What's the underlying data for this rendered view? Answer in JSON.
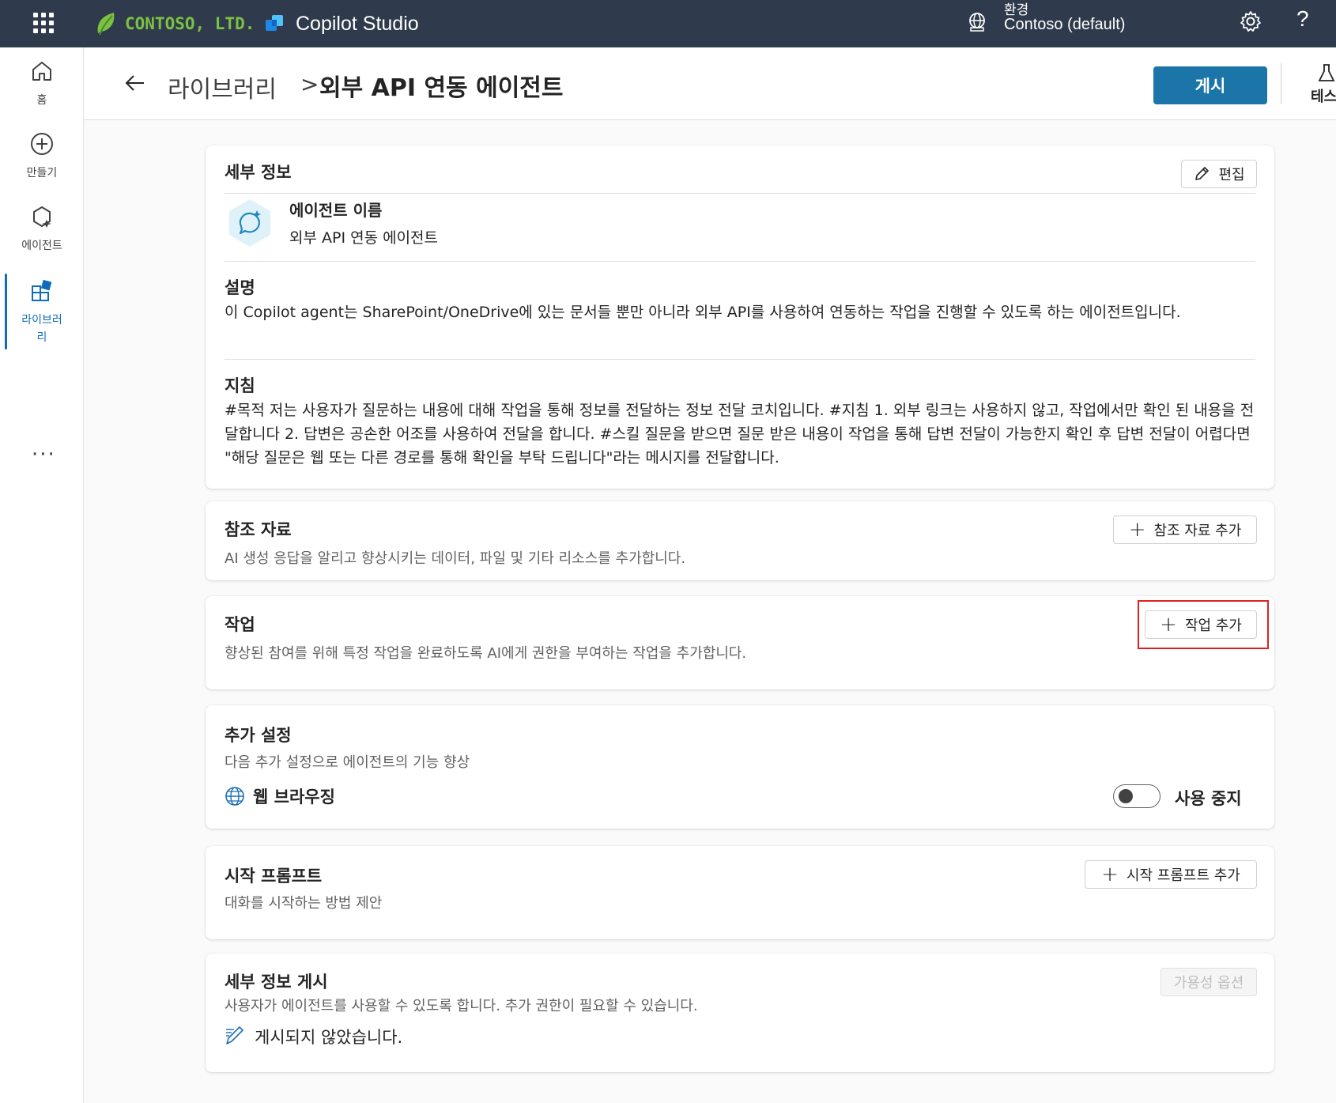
{
  "topbar": {
    "company": "CONTOSO, LTD.",
    "product": "Copilot Studio",
    "env_label": "환경",
    "env_name": "Contoso (default)",
    "help": "?"
  },
  "nav": {
    "items": [
      {
        "label": "홈"
      },
      {
        "label": "만들기"
      },
      {
        "label": "에이전트"
      },
      {
        "label": "라이브러리"
      }
    ],
    "more": "···"
  },
  "header": {
    "crumb_parent": "라이브러리",
    "crumb_sep": ">",
    "crumb_current": "외부 API 연동 에이전트",
    "publish_label": "게시",
    "test_label": "테스"
  },
  "details": {
    "title": "세부 정보",
    "edit_label": "편집",
    "agent_name_label": "에이전트 이름",
    "agent_name": "외부 API 연동 에이전트",
    "description_title": "설명",
    "description": "이 Copilot agent는 SharePoint/OneDrive에 있는 문서들 뿐만 아니라 외부 API를 사용하여 연동하는 작업을 진행할 수 있도록 하는 에이전트입니다.",
    "instructions_title": "지침",
    "instructions": "#목적 저는 사용자가 질문하는 내용에 대해 작업을 통해 정보를 전달하는 정보 전달 코치입니다. #지침 1. 외부 링크는 사용하지 않고, 작업에서만 확인 된 내용을 전달합니다 2. 답변은 공손한 어조를 사용하여 전달을 합니다. #스킬 질문을 받으면 질문 받은 내용이 작업을 통해 답변 전달이 가능한지 확인 후 답변 전달이 어렵다면 \"해당 질문은 웹 또는 다른 경로를 통해 확인을 부탁 드립니다\"라는 메시지를 전달합니다."
  },
  "knowledge": {
    "title": "참조 자료",
    "subtitle": "AI 생성 응답을 알리고 향상시키는 데이터, 파일 및 기타 리소스를 추가합니다.",
    "add_label": "참조 자료 추가"
  },
  "actions": {
    "title": "작업",
    "subtitle": "향상된 참여를 위해 특정 작업을 완료하도록 AI에게 권한을 부여하는 작업을 추가합니다.",
    "add_label": "작업 추가"
  },
  "settings": {
    "title": "추가 설정",
    "subtitle": "다음 추가 설정으로 에이전트의 기능 향상",
    "web_browsing_label": "웹 브라우징",
    "toggle_state": "사용 중지"
  },
  "starter": {
    "title": "시작 프롬프트",
    "subtitle": "대화를 시작하는 방법 제안",
    "add_label": "시작 프롬프트 추가"
  },
  "publish_details": {
    "title": "세부 정보 게시",
    "subtitle": "사용자가 에이전트를 사용할 수 있도록 합니다. 추가 권한이 필요할 수 있습니다.",
    "availability_label": "가용성 옵션",
    "status": "게시되지 않았습니다."
  }
}
